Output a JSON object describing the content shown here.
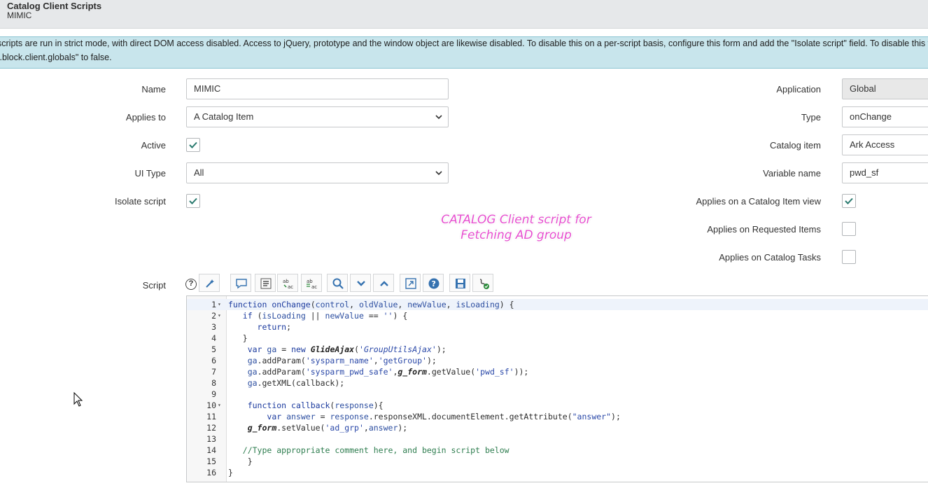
{
  "header": {
    "title": "Catalog Client Scripts",
    "subtitle": "MIMIC"
  },
  "notice": {
    "line1": "scripts are run in strict mode, with direct DOM access disabled. Access to jQuery, prototype and the window object are likewise disabled. To disable this on a per-script basis, configure this form and add the \"Isolate script\" field. To disable this featur",
    "line2": "t.block.client.globals\" to false."
  },
  "form": {
    "name_label": "Name",
    "name_value": "MIMIC",
    "applies_to_label": "Applies to",
    "applies_to_value": "A Catalog Item",
    "active_label": "Active",
    "active_checked": true,
    "ui_type_label": "UI Type",
    "ui_type_value": "All",
    "isolate_label": "Isolate script",
    "isolate_checked": true,
    "application_label": "Application",
    "application_value": "Global",
    "type_label": "Type",
    "type_value": "onChange",
    "catalog_item_label": "Catalog item",
    "catalog_item_value": "Ark Access",
    "variable_label": "Variable name",
    "variable_value": "pwd_sf",
    "applies_view_label": "Applies on a Catalog Item view",
    "applies_view_checked": true,
    "applies_req_label": "Applies on Requested Items",
    "applies_req_checked": false,
    "applies_tasks_label": "Applies on Catalog Tasks",
    "applies_tasks_checked": false,
    "script_label": "Script"
  },
  "annotation": {
    "line1": "CATALOG Client script for",
    "line2": "Fetching AD group"
  },
  "script": {
    "help_glyph": "?",
    "lines": [
      "function onChange(control, oldValue, newValue, isLoading) {",
      "   if (isLoading || newValue == '') {",
      "      return;",
      "   }",
      "    var ga = new GlideAjax('GroupUtilsAjax');",
      "    ga.addParam('sysparm_name','getGroup');",
      "    ga.addParam('sysparm_pwd_safe',g_form.getValue('pwd_sf'));",
      "    ga.getXML(callback);",
      "",
      "    function callback(response){",
      "        var answer = response.responseXML.documentElement.getAttribute(\"answer\");",
      "    g_form.setValue('ad_grp',answer);",
      "",
      "   //Type appropriate comment here, and begin script below",
      "    }",
      "}"
    ],
    "fold_lines": [
      1,
      2,
      10
    ]
  },
  "colors": {
    "check": "#2a7a6f",
    "accent": "#3572b0",
    "annotation": "#e64fcf"
  }
}
